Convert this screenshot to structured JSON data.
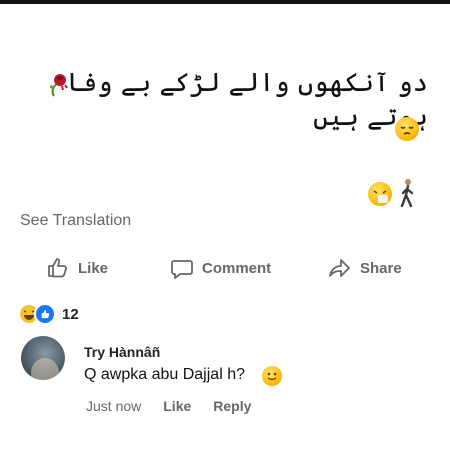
{
  "post": {
    "urdu_text": "دو آنکھوں والے لڑکے بے وفا ہوتے ہیں",
    "emojis": [
      "rose-wilted",
      "pensive-face",
      "sneezing-face",
      "person-walking"
    ]
  },
  "see_translation": "See Translation",
  "actions": {
    "like": "Like",
    "comment": "Comment",
    "share": "Share"
  },
  "reactions": {
    "types": [
      "haha",
      "like"
    ],
    "count": "12"
  },
  "comment": {
    "author": "Try Hànnâñ",
    "text": "Q awpka abu Dajjal h?",
    "time": "Just now",
    "like": "Like",
    "reply": "Reply"
  },
  "colors": {
    "meta_gray": "#65676b",
    "like_blue": "#1877f2"
  }
}
